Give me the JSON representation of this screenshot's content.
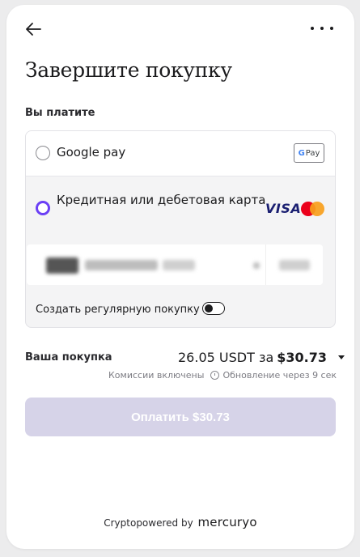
{
  "header": {
    "back_icon": "arrow-left-icon",
    "more_icon": "more-dots-icon"
  },
  "title": "Завершите покупку",
  "payment": {
    "label": "Вы платите",
    "methods": [
      {
        "label": "Google pay",
        "badge": "Pay",
        "selected": false
      },
      {
        "label": "Кредитная или дебетовая карта",
        "brand_visa": "VISA",
        "selected": true
      }
    ],
    "card_input_masked": true,
    "recurring_label": "Создать регулярную покупку",
    "recurring_enabled": false
  },
  "purchase": {
    "label": "Ваша покупка",
    "amount_text": "26.05 USDT за",
    "amount_price": "$30.73",
    "fees_text": "Комиссии включены",
    "refresh_text": "Обновление через 9 сек"
  },
  "pay_button": "Оплатить $30.73",
  "footer": {
    "prefix": "Cryptopowered by",
    "brand": "mercuryo"
  },
  "colors": {
    "accent": "#6b3ff5",
    "button_disabled": "#d6d3e8",
    "visa": "#1a1f71",
    "mc_red": "#eb001b",
    "mc_orange": "#f79e1b"
  }
}
